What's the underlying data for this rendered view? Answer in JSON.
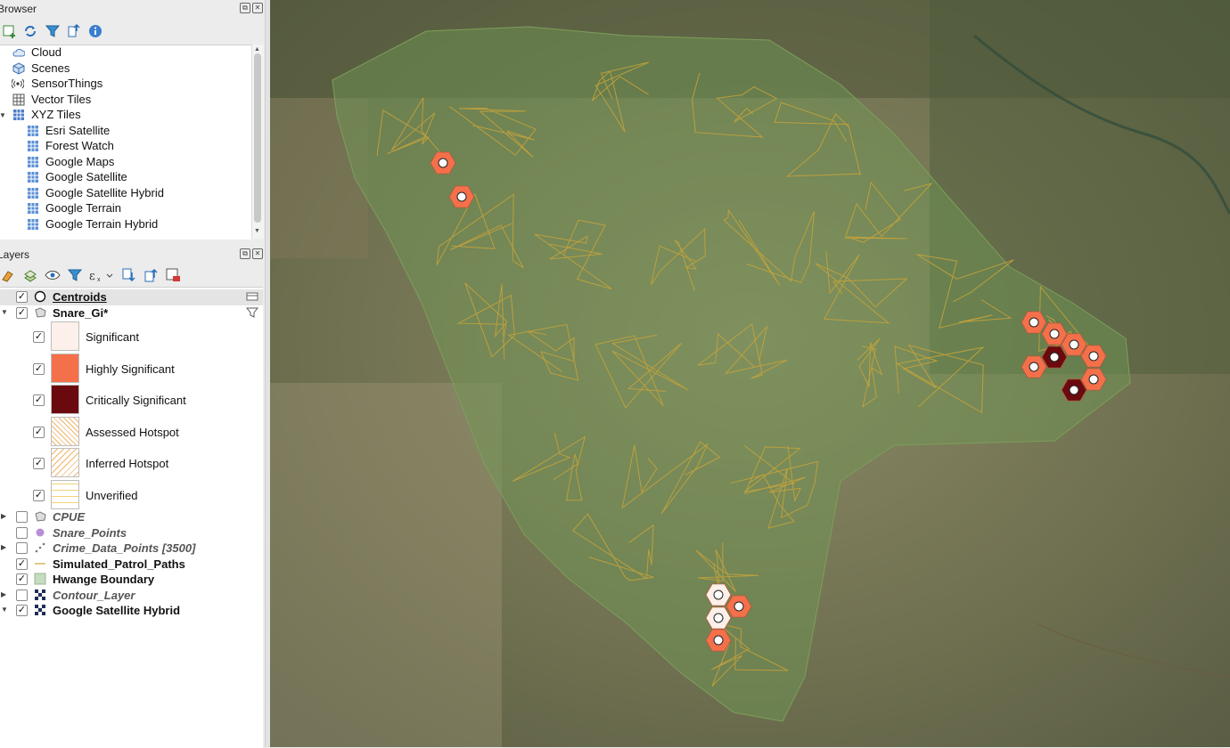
{
  "browser": {
    "title": "Browser",
    "items": [
      {
        "label": "Cloud",
        "icon": "cloud-icon"
      },
      {
        "label": "Scenes",
        "icon": "cube-icon"
      },
      {
        "label": "SensorThings",
        "icon": "sensor-icon"
      },
      {
        "label": "Vector Tiles",
        "icon": "grid-icon"
      },
      {
        "label": "XYZ Tiles",
        "icon": "grid-icon"
      },
      {
        "label": "Esri Satellite",
        "icon": "tile-icon"
      },
      {
        "label": "Forest Watch",
        "icon": "tile-icon"
      },
      {
        "label": "Google Maps",
        "icon": "tile-icon"
      },
      {
        "label": "Google Satellite",
        "icon": "tile-icon"
      },
      {
        "label": "Google Satellite Hybrid",
        "icon": "tile-icon"
      },
      {
        "label": "Google Terrain",
        "icon": "tile-icon"
      },
      {
        "label": "Google Terrain Hybrid",
        "icon": "tile-icon"
      }
    ]
  },
  "layers": {
    "title": "Layers",
    "items": [
      {
        "label": "Centroids",
        "checked": true
      },
      {
        "label": "Snare_Gi*",
        "checked": true
      },
      {
        "label": "CPUE",
        "checked": false
      },
      {
        "label": "Snare_Points",
        "checked": false
      },
      {
        "label": "Crime_Data_Points [3500]",
        "checked": false
      },
      {
        "label": "Simulated_Patrol_Paths",
        "checked": true
      },
      {
        "label": "Hwange Boundary",
        "checked": true
      },
      {
        "label": "Contour_Layer",
        "checked": false
      },
      {
        "label": "Google Satellite Hybrid",
        "checked": true
      }
    ],
    "legend": [
      {
        "label": "Significant",
        "color": "#fdf0ea"
      },
      {
        "label": "Highly Significant",
        "color": "#f4704b"
      },
      {
        "label": "Critically Significant",
        "color": "#6b0a0e"
      },
      {
        "label": "Assessed Hotspot",
        "color": "#f0b46a"
      },
      {
        "label": "Inferred Hotspot",
        "color": "#f0b46a"
      },
      {
        "label": "Unverified",
        "color": "#f5d27a"
      }
    ]
  },
  "map": {
    "hexes": [
      {
        "cls": "highly",
        "fill": "#f4704b"
      },
      {
        "cls": "critical",
        "fill": "#6b0a0e"
      },
      {
        "cls": "significant",
        "fill": "#fdf0ea"
      }
    ],
    "boundary_color": "#7d9f5a",
    "path_color": "#c9a43a"
  }
}
